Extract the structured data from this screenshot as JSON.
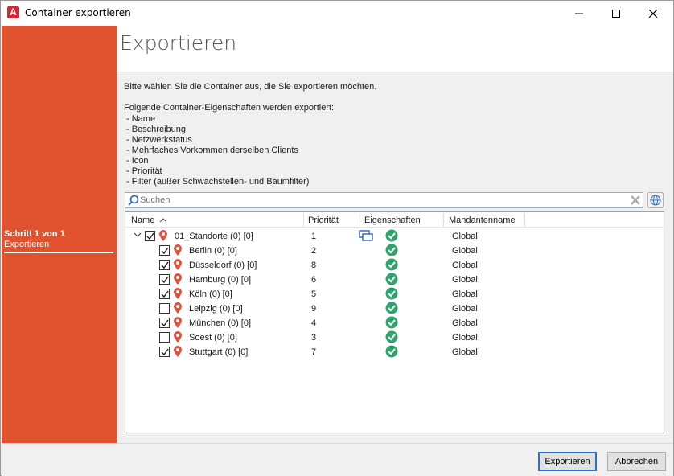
{
  "window": {
    "title": "Container exportieren"
  },
  "steps": {
    "number_label": "Schritt 1 von 1",
    "current": "Exportieren"
  },
  "header": {
    "title": "Exportieren"
  },
  "content": {
    "intro": "Bitte wählen Sie die Container aus, die Sie exportieren möchten.",
    "props_heading": "Folgende Container-Eigenschaften werden exportiert:",
    "props": [
      "- Name",
      "- Beschreibung",
      "- Netzwerkstatus",
      "- Mehrfaches Vorkommen derselben Clients",
      "- Icon",
      "- Priorität",
      "- Filter (außer Schwachstellen- und Baumfilter)"
    ]
  },
  "search": {
    "placeholder": "Suchen"
  },
  "grid": {
    "columns": {
      "name": "Name",
      "priority": "Priorität",
      "properties": "Eigenschaften",
      "client": "Mandantenname"
    },
    "root": {
      "name": "01_Standorte (0) [0]",
      "priority": "1",
      "checked": true,
      "client": "Global"
    },
    "children": [
      {
        "name": "Berlin (0) [0]",
        "priority": "2",
        "checked": true,
        "client": "Global"
      },
      {
        "name": "Düsseldorf (0) [0]",
        "priority": "8",
        "checked": true,
        "client": "Global"
      },
      {
        "name": "Hamburg (0) [0]",
        "priority": "6",
        "checked": true,
        "client": "Global"
      },
      {
        "name": "Köln (0) [0]",
        "priority": "5",
        "checked": true,
        "client": "Global"
      },
      {
        "name": "Leipzig (0) [0]",
        "priority": "9",
        "checked": false,
        "client": "Global"
      },
      {
        "name": "München (0) [0]",
        "priority": "4",
        "checked": true,
        "client": "Global"
      },
      {
        "name": "Soest (0) [0]",
        "priority": "3",
        "checked": false,
        "client": "Global"
      },
      {
        "name": "Stuttgart (0) [0]",
        "priority": "7",
        "checked": true,
        "client": "Global"
      }
    ]
  },
  "footer": {
    "export_label": "Exportieren",
    "cancel_label": "Abbrechen"
  },
  "colors": {
    "accent": "#e0532e",
    "pin": "#e0523a",
    "check_ok": "#2fa36b",
    "focus_border": "#2b6fd1"
  },
  "icons": {
    "app": "app-logo-icon",
    "root_props": [
      "multi-screen-icon",
      "check-circle-icon"
    ],
    "child_props": [
      "check-circle-icon"
    ],
    "node": "map-pin-icon"
  }
}
